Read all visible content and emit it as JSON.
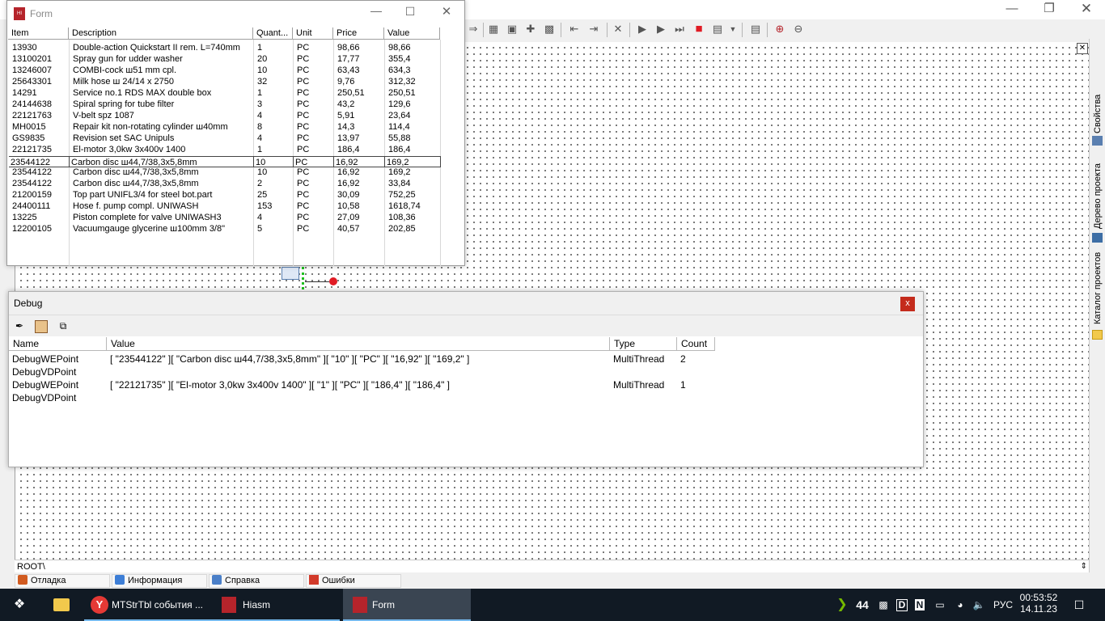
{
  "form": {
    "title": "Form",
    "columns": [
      "Item",
      "Description",
      "Quant...",
      "Unit",
      "Price",
      "Value"
    ],
    "rows": [
      [
        "13930",
        "Double-action Quickstart II rem. L=740mm",
        "1",
        "PC",
        "98,66",
        "98,66"
      ],
      [
        "13100201",
        "Spray gun for udder washer",
        "20",
        "PC",
        "17,77",
        "355,4"
      ],
      [
        "13246007",
        "COMBI-cock ш51 mm cpl.",
        "10",
        "PC",
        "63,43",
        "634,3"
      ],
      [
        "25643301",
        "Milk hose ш 24/14 x 2750",
        "32",
        "PC",
        "9,76",
        "312,32"
      ],
      [
        "14291",
        "Service no.1 RDS MAX double box",
        "1",
        "PC",
        "250,51",
        "250,51"
      ],
      [
        "24144638",
        "Spiral spring for tube filter",
        "3",
        "PC",
        "43,2",
        "129,6"
      ],
      [
        "22121763",
        "V-belt spz 1087",
        "4",
        "PC",
        "5,91",
        "23,64"
      ],
      [
        "MH0015",
        "Repair kit non-rotating cylinder ш40mm",
        "8",
        "PC",
        "14,3",
        "114,4"
      ],
      [
        "GS9835",
        "Revision set SAC Unipuls",
        "4",
        "PC",
        "13,97",
        "55,88"
      ],
      [
        "22121735",
        "El-motor 3,0kw 3x400v 1400",
        "1",
        "PC",
        "186,4",
        "186,4"
      ],
      [
        "23544122",
        "Carbon disc ш44,7/38,3x5,8mm",
        "10",
        "PC",
        "16,92",
        "169,2"
      ],
      [
        "23544122",
        "Carbon disc ш44,7/38,3x5,8mm",
        "10",
        "PC",
        "16,92",
        "169,2"
      ],
      [
        "23544122",
        "Carbon disc ш44,7/38,3x5,8mm",
        "2",
        "PC",
        "16,92",
        "33,84"
      ],
      [
        "21200159",
        "Top part UNIFL3/4 for steel bot.part",
        "25",
        "PC",
        "30,09",
        "752,25"
      ],
      [
        "24400111",
        "Hose f. pump compl. UNIWASH",
        "153",
        "PC",
        "10,58",
        "1618,74"
      ],
      [
        "13225",
        "Piston complete for valve UNIWASH3",
        "4",
        "PC",
        "27,09",
        "108,36"
      ],
      [
        "12200105",
        "Vacuumgauge glycerine ш100mm 3/8\"",
        "5",
        "PC",
        "40,57",
        "202,85"
      ]
    ],
    "selected_row": 10
  },
  "debug": {
    "title": "Debug",
    "close": "x",
    "columns": [
      "Name",
      "Value",
      "Type",
      "Count"
    ],
    "rows": [
      [
        "DebugWEPoint",
        "[ \"23544122\" ][ \"Carbon disc ш44,7/38,3x5,8mm\" ][ \"10\" ][ \"PC\" ][ \"16,92\" ][ \"169,2\" ]",
        "MultiThread",
        "2"
      ],
      [
        "DebugVDPoint",
        "",
        "",
        ""
      ],
      [
        "DebugWEPoint",
        "[ \"22121735\" ][ \"El-motor 3,0kw 3x400v 1400\" ][ \"1\" ][ \"PC\" ][ \"186,4\" ][ \"186,4\" ]",
        "MultiThread",
        "1"
      ],
      [
        "DebugVDPoint",
        "",
        "",
        ""
      ]
    ]
  },
  "side_tabs": [
    "Свойства",
    "Дерево проекта",
    "Каталог проектов"
  ],
  "path": "ROOT\\",
  "bottom_tabs": [
    "Отладка",
    "Информация",
    "Справка",
    "Ошибки"
  ],
  "taskbar": {
    "apps": [
      "MTStrTbl события ...",
      "Hiasm",
      "Form"
    ],
    "tray_count": "44",
    "lang": "РУС",
    "time": "00:53:52",
    "date": "14.11.23"
  },
  "colors": {
    "accent": "#76b9ed",
    "debug_close": "#c42b1c",
    "taskbar": "#111a24"
  }
}
